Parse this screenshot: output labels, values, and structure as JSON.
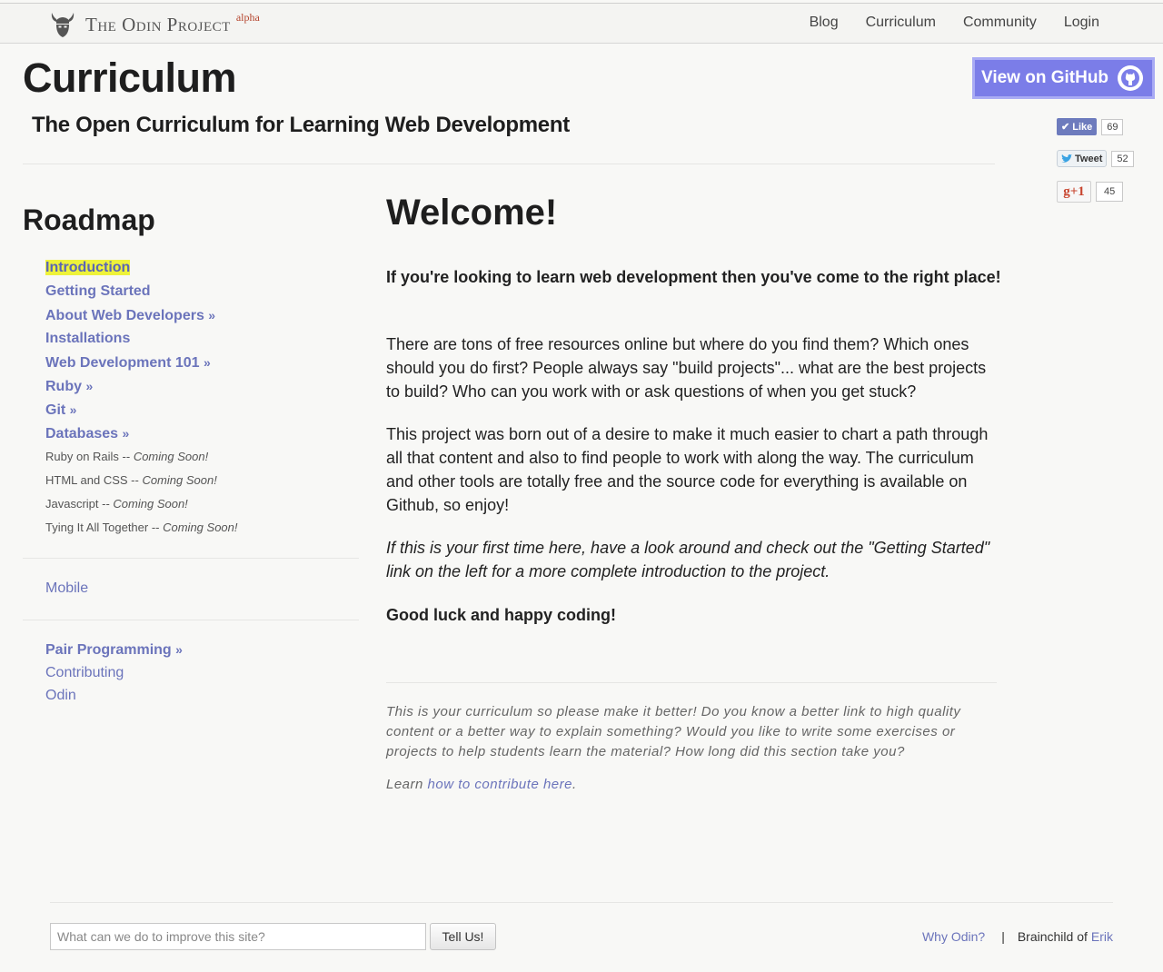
{
  "brand": {
    "name": "The Odin Project",
    "tag": "alpha",
    "logo_icon": "odin-viking-helmet-icon"
  },
  "nav": {
    "items": [
      "Blog",
      "Curriculum",
      "Community",
      "Login"
    ]
  },
  "header": {
    "title": "Curriculum",
    "subtitle": "The Open Curriculum for Learning Web Development"
  },
  "github": {
    "label": "View on GitHub",
    "icon": "github-octocat-icon"
  },
  "social": {
    "like": {
      "label": "Like",
      "count": "69"
    },
    "tweet": {
      "label": "Tweet",
      "count": "52"
    },
    "gplus": {
      "label": "g+1",
      "count": "45"
    }
  },
  "sidebar": {
    "title": "Roadmap",
    "items": [
      {
        "label": "Introduction",
        "arrow": ""
      },
      {
        "label": "Getting Started",
        "arrow": ""
      },
      {
        "label": "About Web Developers",
        "arrow": "»"
      },
      {
        "label": "Installations",
        "arrow": ""
      },
      {
        "label": "Web Development 101",
        "arrow": "»"
      },
      {
        "label": "Ruby",
        "arrow": "»"
      },
      {
        "label": "Git",
        "arrow": "»"
      },
      {
        "label": "Databases",
        "arrow": "»"
      }
    ],
    "coming_soon": [
      {
        "label": "Ruby on Rails -- ",
        "note": "Coming Soon!"
      },
      {
        "label": "HTML and CSS -- ",
        "note": "Coming Soon!"
      },
      {
        "label": "Javascript -- ",
        "note": "Coming Soon!"
      },
      {
        "label": "Tying It All Together -- ",
        "note": "Coming Soon!"
      }
    ],
    "mobile": "Mobile",
    "pair_programming": "Pair Programming",
    "pair_arrow": "»",
    "contributing": "Contributing",
    "odin": "Odin"
  },
  "main": {
    "heading": "Welcome!",
    "intro": "If you're looking to learn web development then you've come to the right place!",
    "p1": "There are tons of free resources online but where do you find them? Which ones should you do first? People always say \"build projects\"... what are the best projects to build? Who can you work with or ask questions of when you get stuck?",
    "p2": "This project was born out of a desire to make it much easier to chart a path through all that content and also to find people to work with along the way. The curriculum and other tools are totally free and the source code for everything is available on Github, so enjoy!",
    "p3": "If this is your first time here, have a look around and check out the \"Getting Started\" link on the left for a more complete introduction to the project.",
    "closing": "Good luck and happy coding!",
    "contrib": "This is your curriculum so please make it better! Do you know a better link to high quality content or a better way to explain something? Would you like to write some exercises or projects to help students learn the material? How long did this section take you?",
    "learn_prefix": "Learn ",
    "learn_link": "how to contribute here",
    "learn_suffix": "."
  },
  "footer": {
    "placeholder": "What can we do to improve this site?",
    "button": "Tell Us!",
    "why_odin": "Why Odin?",
    "separator": "|",
    "brainchild_prefix": "Brainchild of ",
    "brainchild_name": "Erik"
  },
  "colors": {
    "link": "#6b74bb",
    "github_button": "#7b7de8",
    "highlight": "#eef23a",
    "alpha_tag": "#b5462f"
  }
}
